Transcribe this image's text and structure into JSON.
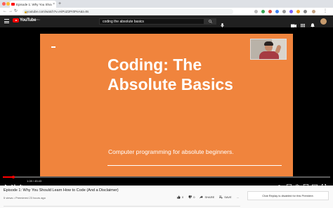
{
  "browser": {
    "tab_title": "Episode 1: Why You Should Lea",
    "tab_close": "×",
    "new_tab": "+",
    "url": "youtube.com/watch?v=HiPoZ2Pr0PeA&t=8s",
    "colors": {
      "close": "#ff5f57",
      "minimize": "#febc2e",
      "zoom": "#28c840"
    }
  },
  "youtube": {
    "logo_text": "YouTube",
    "logo_sup": "PH",
    "search_value": "coding the absolute basics"
  },
  "slide": {
    "title_line1": "Coding: The",
    "title_line2": "Absolute Basics",
    "subtitle": "Computer programming for absolute beginners.",
    "background": "#f0843d"
  },
  "player": {
    "time_display": "1:28 / 45:43",
    "progress": 0.032,
    "accent": "#ff0000"
  },
  "video": {
    "title": "Episode 1: Why You Should Learn How to Code (And a Disclaimer)",
    "meta": "5 views • Premiered 23 hours ago",
    "likes": "0",
    "dislikes": "0",
    "share_label": "SHARE",
    "save_label": "SAVE",
    "more_label": "..."
  },
  "chat": {
    "notice": "Chat Replay is disabled for this Premiere."
  }
}
